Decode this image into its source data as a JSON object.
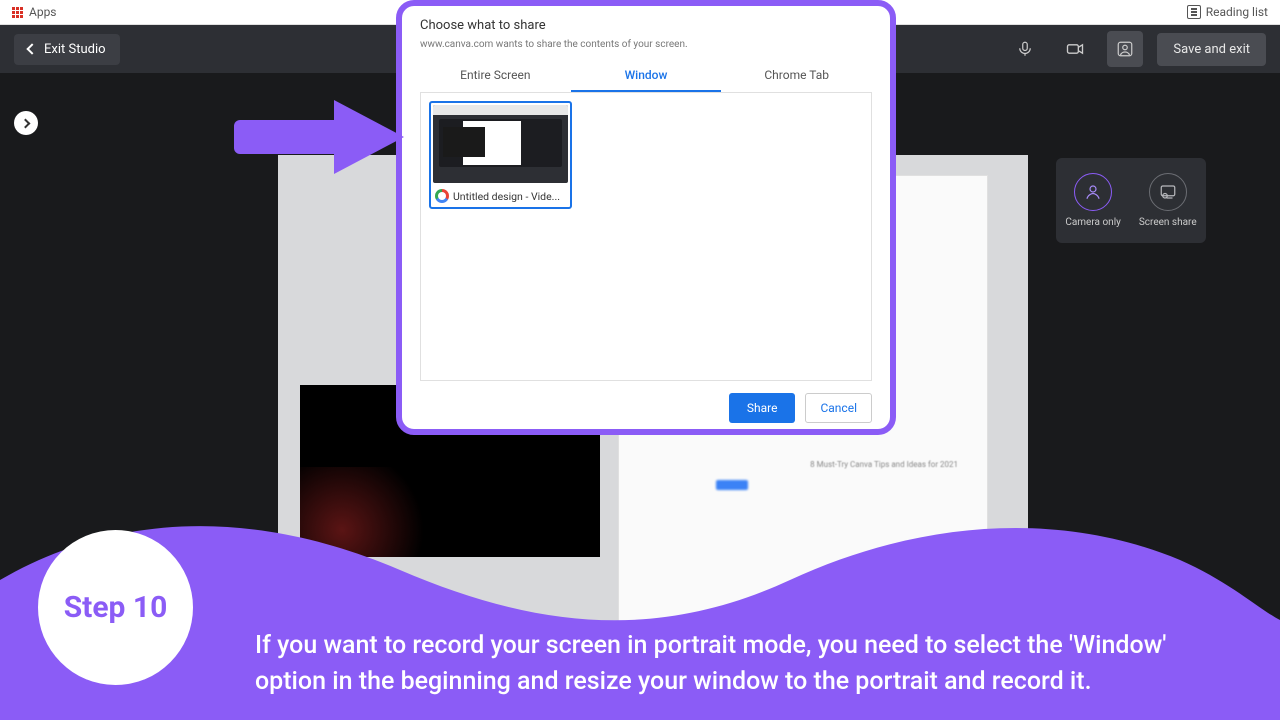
{
  "browser": {
    "apps_label": "Apps",
    "reading_list": "Reading list"
  },
  "header": {
    "exit_studio": "Exit Studio",
    "save_and_exit": "Save and exit"
  },
  "panel": {
    "camera_only": "Camera only",
    "screen_share": "Screen share"
  },
  "dialog": {
    "title": "Choose what to share",
    "subtitle": "www.canva.com wants to share the contents of your screen.",
    "tab_entire": "Entire Screen",
    "tab_window": "Window",
    "tab_chrome": "Chrome Tab",
    "thumb_caption": "Untitled design - Vide...",
    "share": "Share",
    "cancel": "Cancel"
  },
  "canvas": {
    "blurred_line": "8 Must-Try Canva Tips and Ideas for 2021"
  },
  "step": {
    "badge": "Step 10",
    "text": "If you want to record your screen in portrait mode, you need to select the 'Window' option in the beginning and resize your window to the portrait and record it."
  }
}
